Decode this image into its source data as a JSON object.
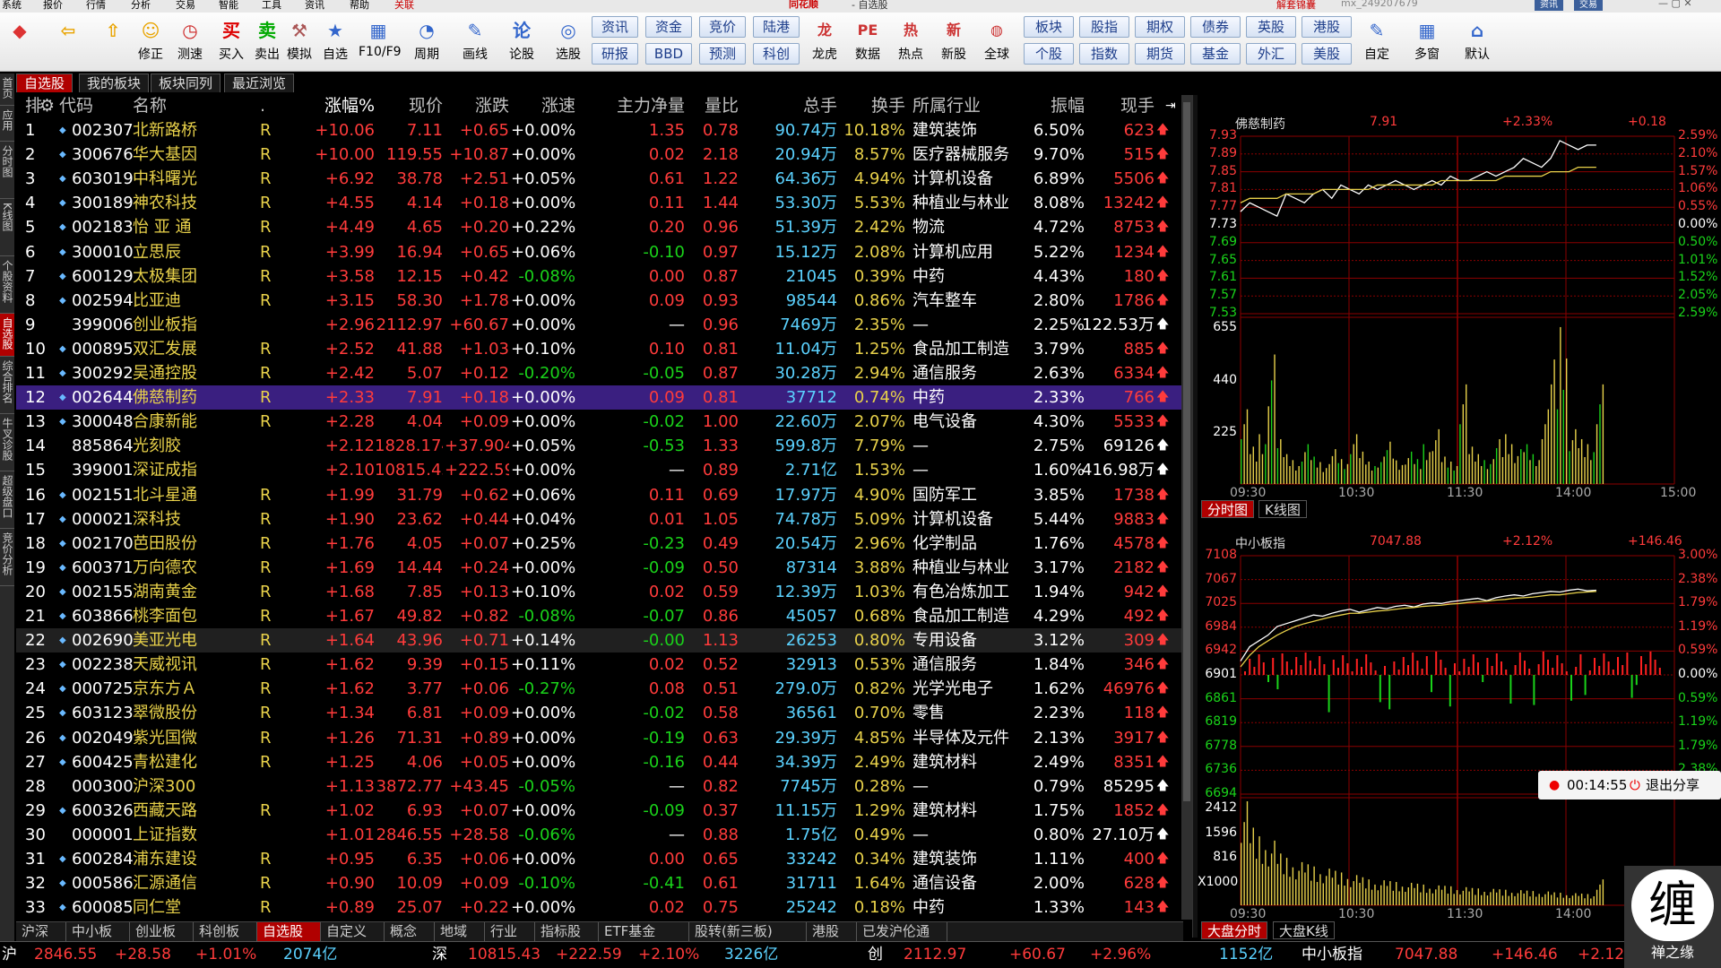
{
  "menubar": {
    "items": [
      "系统",
      "报价",
      "行情",
      "分析",
      "交易",
      "智能",
      "工具",
      "资讯",
      "帮助",
      "关联"
    ],
    "brand": "同花顺",
    "window_title": "- 自选股",
    "account_label": "解套锦囊",
    "account_id": "mx_249207679",
    "btn_news": "资讯",
    "btn_lang": "交易"
  },
  "toolbar": {
    "tools": [
      {
        "icon": "◆",
        "label": ""
      },
      {
        "icon": "⇦",
        "label": ""
      },
      {
        "icon": "⇧",
        "label": ""
      },
      {
        "icon": "☺",
        "label": "修正"
      },
      {
        "icon": "◷",
        "label": "测速"
      },
      {
        "icon": "买",
        "label": "买入"
      },
      {
        "icon": "卖",
        "label": "卖出"
      },
      {
        "icon": "⚒",
        "label": "模拟"
      },
      {
        "icon": "★",
        "label": "自选"
      },
      {
        "icon": "▦",
        "label": "F10/F9"
      },
      {
        "icon": "◔",
        "label": "周期"
      },
      {
        "icon": "✎",
        "label": "画线"
      },
      {
        "icon": "论",
        "label": "论股"
      },
      {
        "icon": "◎",
        "label": "选股"
      }
    ],
    "buttons_top": [
      "资讯",
      "资金",
      "竞价",
      "陆港"
    ],
    "buttons_bottom": [
      "研报",
      "BBD",
      "预测",
      "科创"
    ],
    "tools2": [
      {
        "icon": "龙",
        "label": "龙虎"
      },
      {
        "icon": "PE",
        "label": "数据"
      },
      {
        "icon": "热",
        "label": "热点"
      },
      {
        "icon": "新",
        "label": "新股"
      },
      {
        "icon": "◍",
        "label": "全球"
      }
    ],
    "buttons2_top": [
      "板块",
      "股指",
      "期权",
      "债券",
      "英股",
      "港股"
    ],
    "buttons2_bottom": [
      "个股",
      "指数",
      "期货",
      "基金",
      "外汇",
      "美股"
    ],
    "tools3": [
      {
        "icon": "✎",
        "label": "自定"
      },
      {
        "icon": "▦",
        "label": "多窗"
      },
      {
        "icon": "⌂",
        "label": "默认"
      }
    ]
  },
  "top_tabs": [
    "自选股",
    "我的板块",
    "板块同列",
    "最近浏览"
  ],
  "left_vertical": [
    "首页",
    "应用",
    "分时图",
    "K线图",
    "个股资料",
    "自选股",
    "综合排名",
    "牛叉诊股",
    "超级盘口",
    "竞价分析"
  ],
  "table": {
    "headers": [
      "排",
      "代码",
      "名称",
      ".",
      "涨幅%",
      "现价",
      "涨跌",
      "涨速",
      "主力净量",
      "量比",
      "总手",
      "换手",
      "所属行业",
      "振幅",
      "现手"
    ],
    "rows": [
      [
        "1",
        "002307",
        "北新路桥",
        "R",
        "+10.06",
        "7.11",
        "+0.65",
        "+0.00%",
        "1.35",
        "0.78",
        "90.74万",
        "10.18%",
        "建筑装饰",
        "6.50%",
        "623",
        "up"
      ],
      [
        "2",
        "300676",
        "华大基因",
        "R",
        "+10.00",
        "119.55",
        "+10.87",
        "+0.00%",
        "0.02",
        "2.18",
        "20.94万",
        "8.57%",
        "医疗器械服务",
        "9.70%",
        "515",
        "up"
      ],
      [
        "3",
        "603019",
        "中科曙光",
        "R",
        "+6.92",
        "38.78",
        "+2.51",
        "+0.05%",
        "0.61",
        "1.22",
        "64.36万",
        "4.94%",
        "计算机设备",
        "6.89%",
        "5506",
        "up"
      ],
      [
        "4",
        "300189",
        "神农科技",
        "R",
        "+4.55",
        "4.14",
        "+0.18",
        "+0.00%",
        "0.11",
        "1.44",
        "53.30万",
        "5.53%",
        "种植业与林业",
        "8.08%",
        "13242",
        "up"
      ],
      [
        "5",
        "002183",
        "怡 亚 通",
        "R",
        "+4.49",
        "4.65",
        "+0.20",
        "+0.22%",
        "0.20",
        "0.96",
        "51.39万",
        "2.42%",
        "物流",
        "4.72%",
        "8753",
        "up"
      ],
      [
        "6",
        "300010",
        "立思辰",
        "R",
        "+3.99",
        "16.94",
        "+0.65",
        "+0.06%",
        "-0.10",
        "0.97",
        "15.12万",
        "2.08%",
        "计算机应用",
        "5.22%",
        "1234",
        "up"
      ],
      [
        "7",
        "600129",
        "太极集团",
        "R",
        "+3.58",
        "12.15",
        "+0.42",
        "-0.08%",
        "0.00",
        "0.87",
        "21045",
        "0.39%",
        "中药",
        "4.43%",
        "180",
        "up"
      ],
      [
        "8",
        "002594",
        "比亚迪",
        "R",
        "+3.15",
        "58.30",
        "+1.78",
        "+0.00%",
        "0.09",
        "0.93",
        "98544",
        "0.86%",
        "汽车整车",
        "2.80%",
        "1786",
        "up"
      ],
      [
        "9",
        "399006",
        "创业板指",
        "",
        "+2.96",
        "2112.97",
        "+60.67",
        "+0.00%",
        "—",
        "0.96",
        "7469万",
        "2.35%",
        "—",
        "2.25%",
        "122.53万",
        "wup"
      ],
      [
        "10",
        "000895",
        "双汇发展",
        "R",
        "+2.52",
        "41.88",
        "+1.03",
        "+0.10%",
        "0.10",
        "0.81",
        "11.04万",
        "1.25%",
        "食品加工制造",
        "3.79%",
        "885",
        "up"
      ],
      [
        "11",
        "300292",
        "吴通控股",
        "R",
        "+2.42",
        "5.07",
        "+0.12",
        "-0.20%",
        "-0.05",
        "0.87",
        "30.28万",
        "2.94%",
        "通信服务",
        "2.63%",
        "6334",
        "up"
      ],
      [
        "12",
        "002644",
        "佛慈制药",
        "R",
        "+2.33",
        "7.91",
        "+0.18",
        "+0.00%",
        "0.09",
        "0.81",
        "37712",
        "0.74%",
        "中药",
        "2.33%",
        "766",
        "up"
      ],
      [
        "13",
        "300048",
        "合康新能",
        "R",
        "+2.28",
        "4.04",
        "+0.09",
        "+0.00%",
        "-0.02",
        "1.00",
        "22.60万",
        "2.07%",
        "电气设备",
        "4.30%",
        "5533",
        "up"
      ],
      [
        "14",
        "885864",
        "光刻胶",
        "",
        "+2.12",
        "1828.174",
        "+37.904",
        "+0.05%",
        "-0.53",
        "1.33",
        "599.8万",
        "7.79%",
        "—",
        "2.75%",
        "69126",
        "wup"
      ],
      [
        "15",
        "399001",
        "深证成指",
        "",
        "+2.10",
        "10815.43",
        "+222.59",
        "+0.00%",
        "—",
        "0.89",
        "2.71亿",
        "1.53%",
        "—",
        "1.60%",
        "416.98万",
        "wup"
      ],
      [
        "16",
        "002151",
        "北斗星通",
        "R",
        "+1.99",
        "31.79",
        "+0.62",
        "+0.06%",
        "0.11",
        "0.69",
        "17.97万",
        "4.90%",
        "国防军工",
        "3.85%",
        "1738",
        "up"
      ],
      [
        "17",
        "000021",
        "深科技",
        "R",
        "+1.90",
        "23.62",
        "+0.44",
        "+0.04%",
        "0.01",
        "1.05",
        "74.78万",
        "5.09%",
        "计算机设备",
        "5.44%",
        "9883",
        "up"
      ],
      [
        "18",
        "002170",
        "芭田股份",
        "R",
        "+1.76",
        "4.05",
        "+0.07",
        "+0.25%",
        "-0.23",
        "0.49",
        "20.54万",
        "2.96%",
        "化学制品",
        "1.76%",
        "4578",
        "up"
      ],
      [
        "19",
        "600371",
        "万向德农",
        "R",
        "+1.69",
        "14.44",
        "+0.24",
        "+0.00%",
        "-0.09",
        "0.50",
        "87314",
        "3.88%",
        "种植业与林业",
        "3.17%",
        "2182",
        "up"
      ],
      [
        "20",
        "002155",
        "湖南黄金",
        "R",
        "+1.68",
        "7.85",
        "+0.13",
        "+0.10%",
        "0.02",
        "0.59",
        "12.39万",
        "1.03%",
        "有色冶炼加工",
        "1.94%",
        "942",
        "up"
      ],
      [
        "21",
        "603866",
        "桃李面包",
        "R",
        "+1.67",
        "49.82",
        "+0.82",
        "-0.08%",
        "-0.07",
        "0.86",
        "45057",
        "0.68%",
        "食品加工制造",
        "4.29%",
        "492",
        "up"
      ],
      [
        "22",
        "002690",
        "美亚光电",
        "R",
        "+1.64",
        "43.96",
        "+0.71",
        "+0.14%",
        "-0.00",
        "1.13",
        "26253",
        "0.80%",
        "专用设备",
        "3.12%",
        "309",
        "up"
      ],
      [
        "23",
        "002238",
        "天威视讯",
        "R",
        "+1.62",
        "9.39",
        "+0.15",
        "+0.11%",
        "0.02",
        "0.52",
        "32913",
        "0.53%",
        "通信服务",
        "1.84%",
        "346",
        "up"
      ],
      [
        "24",
        "000725",
        "京东方Ａ",
        "R",
        "+1.62",
        "3.77",
        "+0.06",
        "-0.27%",
        "0.08",
        "0.51",
        "279.0万",
        "0.82%",
        "光学光电子",
        "1.62%",
        "46976",
        "up"
      ],
      [
        "25",
        "603123",
        "翠微股份",
        "R",
        "+1.34",
        "6.81",
        "+0.09",
        "+0.00%",
        "-0.02",
        "0.58",
        "36561",
        "0.70%",
        "零售",
        "2.23%",
        "118",
        "up"
      ],
      [
        "26",
        "002049",
        "紫光国微",
        "R",
        "+1.26",
        "71.31",
        "+0.89",
        "+0.00%",
        "-0.19",
        "0.63",
        "29.39万",
        "4.85%",
        "半导体及元件",
        "2.13%",
        "3917",
        "up"
      ],
      [
        "27",
        "600425",
        "青松建化",
        "R",
        "+1.25",
        "4.06",
        "+0.05",
        "+0.00%",
        "-0.16",
        "0.44",
        "34.39万",
        "2.49%",
        "建筑材料",
        "2.49%",
        "8351",
        "up"
      ],
      [
        "28",
        "000300",
        "沪深300",
        "",
        "+1.13",
        "3872.77",
        "+43.45",
        "-0.05%",
        "—",
        "0.82",
        "7745万",
        "0.28%",
        "—",
        "0.79%",
        "85295",
        "wup"
      ],
      [
        "29",
        "600326",
        "西藏天路",
        "R",
        "+1.02",
        "6.93",
        "+0.07",
        "+0.00%",
        "-0.09",
        "0.37",
        "11.15万",
        "1.29%",
        "建筑材料",
        "1.75%",
        "1852",
        "up"
      ],
      [
        "30",
        "000001",
        "上证指数",
        "",
        "+1.01",
        "2846.55",
        "+28.58",
        "-0.06%",
        "—",
        "0.88",
        "1.75亿",
        "0.49%",
        "—",
        "0.80%",
        "27.10万",
        "wup"
      ],
      [
        "31",
        "600284",
        "浦东建设",
        "R",
        "+0.95",
        "6.35",
        "+0.06",
        "+0.00%",
        "0.00",
        "0.65",
        "33242",
        "0.34%",
        "建筑装饰",
        "1.11%",
        "400",
        "up"
      ],
      [
        "32",
        "000586",
        "汇源通信",
        "R",
        "+0.90",
        "10.09",
        "+0.09",
        "-0.10%",
        "-0.41",
        "0.61",
        "31711",
        "1.64%",
        "通信设备",
        "2.00%",
        "628",
        "up"
      ],
      [
        "33",
        "600085",
        "同仁堂",
        "R",
        "+0.89",
        "25.07",
        "+0.22",
        "+0.00%",
        "0.02",
        "0.75",
        "25242",
        "0.18%",
        "中药",
        "1.33%",
        "143",
        "up"
      ]
    ]
  },
  "bottom_tabs": [
    "沪深",
    "中小板",
    "创业板",
    "科创板",
    "自选股",
    "自定义",
    "概念",
    "地域",
    "行业",
    "指标股",
    "ETF基金",
    "股转(新三板)",
    "港股",
    "已发沪伦通"
  ],
  "statusbar": {
    "sh_label": "沪",
    "sh_price": "2846.55",
    "sh_chg": "+28.58",
    "sh_pct": "+1.01%",
    "sh_amt": "2074亿",
    "sz_label": "深",
    "sz_price": "10815.43",
    "sz_chg": "+222.59",
    "sz_pct": "+2.10%",
    "sz_amt": "3226亿",
    "cy_label": "创",
    "cy_price": "2112.97",
    "cy_chg": "+60.67",
    "cy_pct": "+2.96%",
    "cy_amt": "1152亿",
    "zx_label": "中小板指",
    "zx_price": "7047.88",
    "zx_chg": "+146.46",
    "zx_pct": "+2.12%"
  },
  "chart_top": {
    "title": "佛慈制药",
    "price": "7.91",
    "pct": "+2.33%",
    "chg": "+0.18",
    "y_left": [
      "7.93",
      "7.89",
      "7.85",
      "7.81",
      "7.77",
      "7.73",
      "7.69",
      "7.65",
      "7.61",
      "7.57",
      "7.53"
    ],
    "y_right": [
      "2.59%",
      "2.10%",
      "1.57%",
      "1.06%",
      "0.55%",
      "0.00%",
      "0.50%",
      "1.01%",
      "1.52%",
      "2.05%",
      "2.59%"
    ],
    "vol_left": [
      "655",
      "440",
      "225"
    ],
    "time": [
      "09:30",
      "10:30",
      "11:30",
      "14:00",
      "15:00"
    ],
    "price_line": [
      7.76,
      7.78,
      7.77,
      7.76,
      7.75,
      7.8,
      7.79,
      7.78,
      7.8,
      7.81,
      7.79,
      7.82,
      7.81,
      7.8,
      7.82,
      7.81,
      7.82,
      7.83,
      7.82,
      7.81,
      7.82,
      7.83,
      7.82,
      7.84,
      7.83,
      7.83,
      7.84,
      7.85,
      7.84,
      7.85,
      7.86,
      7.88,
      7.87,
      7.86,
      7.88,
      7.92,
      7.91,
      7.9,
      7.91,
      7.91
    ],
    "avg_line": [
      7.78,
      7.79,
      7.79,
      7.79,
      7.79,
      7.8,
      7.8,
      7.8,
      7.8,
      7.81,
      7.81,
      7.81,
      7.81,
      7.81,
      7.81,
      7.82,
      7.82,
      7.82,
      7.82,
      7.82,
      7.82,
      7.82,
      7.83,
      7.83,
      7.83,
      7.83,
      7.83,
      7.83,
      7.83,
      7.84,
      7.84,
      7.84,
      7.84,
      7.84,
      7.85,
      7.85,
      7.85,
      7.86,
      7.86,
      7.86
    ],
    "volumes": [
      300,
      150,
      200,
      520,
      180,
      120,
      90,
      160,
      110,
      80,
      140,
      100,
      200,
      130,
      90,
      110,
      170,
      95,
      130,
      100,
      160,
      220,
      110,
      90,
      400,
      150,
      120,
      100,
      180,
      200,
      140,
      160,
      120,
      300,
      500,
      630,
      220,
      180,
      160,
      400
    ]
  },
  "pane_tabs": [
    "分时图",
    "K线图"
  ],
  "chart_bottom": {
    "title": "中小板指",
    "price": "7047.88",
    "pct": "+2.12%",
    "chg": "+146.46",
    "y_left": [
      "7108",
      "7067",
      "7025",
      "6984",
      "6942",
      "6901",
      "6861",
      "6819",
      "6778",
      "6736",
      "6694"
    ],
    "y_right": [
      "3.00%",
      "2.38%",
      "1.79%",
      "1.19%",
      "0.59%",
      "0.00%",
      "0.59%",
      "1.19%",
      "1.79%",
      "2.38%",
      "3.00%"
    ],
    "vol_left": [
      "2412",
      "1596",
      "816",
      "X1000"
    ],
    "time": [
      "09:30",
      "10:30",
      "11:30",
      "14:00"
    ],
    "price_line": [
      6925,
      6950,
      6960,
      6970,
      6985,
      6990,
      6995,
      7000,
      7005,
      7003,
      7008,
      7012,
      7015,
      7010,
      7014,
      7018,
      7016,
      7020,
      7022,
      7019,
      7024,
      7026,
      7025,
      7028,
      7030,
      7032,
      7034,
      7030,
      7035,
      7038,
      7040,
      7038,
      7042,
      7044,
      7046,
      7045,
      7048,
      7050,
      7047,
      7048
    ],
    "avg_line": [
      6915,
      6935,
      6950,
      6960,
      6970,
      6978,
      6985,
      6990,
      6994,
      6998,
      7002,
      7005,
      7008,
      7008,
      7010,
      7012,
      7013,
      7015,
      7017,
      7018,
      7020,
      7021,
      7022,
      7024,
      7025,
      7027,
      7028,
      7029,
      7031,
      7032,
      7034,
      7035,
      7036,
      7038,
      7040,
      7040,
      7042,
      7044,
      7045,
      7046
    ],
    "volumes": [
      2412,
      1800,
      1600,
      1500,
      1200,
      1100,
      1000,
      950,
      900,
      850,
      800,
      760,
      700,
      650,
      600,
      580,
      560,
      540,
      520,
      500,
      480,
      460,
      450,
      440,
      420,
      400,
      390,
      380,
      370,
      360,
      350,
      340,
      330,
      320,
      300,
      290,
      280,
      270,
      260,
      600
    ]
  },
  "bottom_pane_tabs": [
    "大盘分时",
    "大盘K线"
  ],
  "share": {
    "time": "00:14:55",
    "exit": "退出分享"
  },
  "logo": {
    "char": "缠",
    "text": "禅之缘"
  },
  "colors": {
    "up": "#ff3b3b",
    "down": "#1ad31a",
    "select": "#3a1f80",
    "active_tab": "#b00000",
    "grid": "#8b0000"
  }
}
